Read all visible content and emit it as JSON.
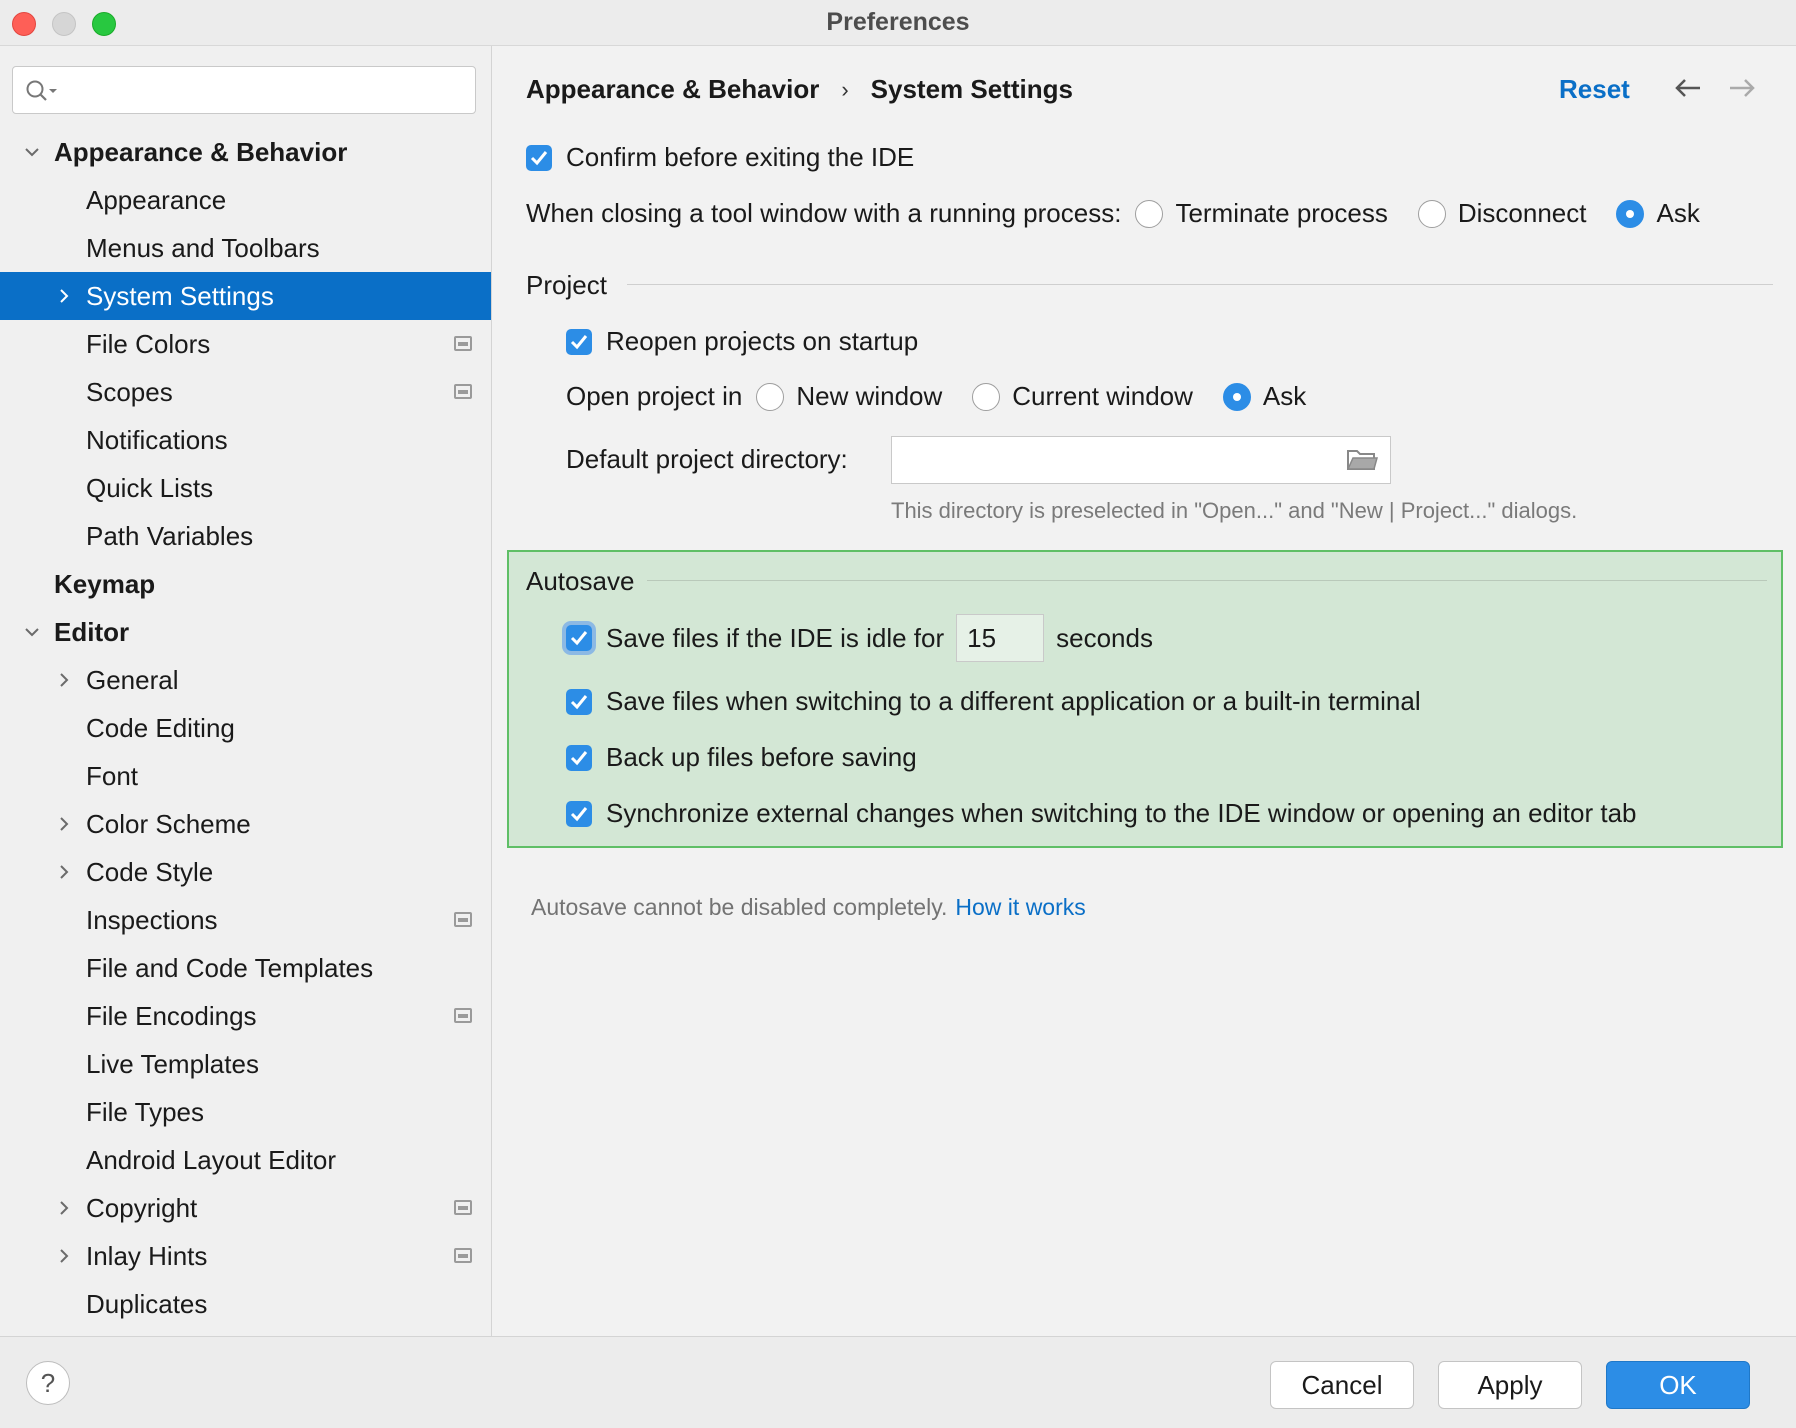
{
  "window": {
    "title": "Preferences"
  },
  "sidebar": {
    "search": {
      "placeholder": ""
    },
    "items": [
      {
        "label": "Appearance & Behavior",
        "level": 0,
        "bold": true,
        "arrow": "down"
      },
      {
        "label": "Appearance",
        "level": 1
      },
      {
        "label": "Menus and Toolbars",
        "level": 1
      },
      {
        "label": "System Settings",
        "level": 1,
        "arrow": "right",
        "selected": true
      },
      {
        "label": "File Colors",
        "level": 1,
        "project": true
      },
      {
        "label": "Scopes",
        "level": 1,
        "project": true
      },
      {
        "label": "Notifications",
        "level": 1
      },
      {
        "label": "Quick Lists",
        "level": 1
      },
      {
        "label": "Path Variables",
        "level": 1
      },
      {
        "label": "Keymap",
        "level": 0,
        "bold": true
      },
      {
        "label": "Editor",
        "level": 0,
        "bold": true,
        "arrow": "down"
      },
      {
        "label": "General",
        "level": 1,
        "arrow": "right"
      },
      {
        "label": "Code Editing",
        "level": 1
      },
      {
        "label": "Font",
        "level": 1
      },
      {
        "label": "Color Scheme",
        "level": 1,
        "arrow": "right"
      },
      {
        "label": "Code Style",
        "level": 1,
        "arrow": "right"
      },
      {
        "label": "Inspections",
        "level": 1,
        "project": true
      },
      {
        "label": "File and Code Templates",
        "level": 1
      },
      {
        "label": "File Encodings",
        "level": 1,
        "project": true
      },
      {
        "label": "Live Templates",
        "level": 1
      },
      {
        "label": "File Types",
        "level": 1
      },
      {
        "label": "Android Layout Editor",
        "level": 1
      },
      {
        "label": "Copyright",
        "level": 1,
        "arrow": "right",
        "project": true
      },
      {
        "label": "Inlay Hints",
        "level": 1,
        "arrow": "right",
        "project": true
      },
      {
        "label": "Duplicates",
        "level": 1
      }
    ]
  },
  "header": {
    "breadcrumb_parent": "Appearance & Behavior",
    "breadcrumb_sep": "›",
    "breadcrumb_current": "System Settings",
    "reset_label": "Reset"
  },
  "general": {
    "confirm_exit_label": "Confirm before exiting the IDE",
    "confirm_exit_checked": true,
    "closing_tool_label": "When closing a tool window with a running process:",
    "closing_options": [
      "Terminate process",
      "Disconnect",
      "Ask"
    ],
    "closing_selected": "Ask"
  },
  "project": {
    "title": "Project",
    "reopen_label": "Reopen projects on startup",
    "reopen_checked": true,
    "open_in_label": "Open project in",
    "open_options": [
      "New window",
      "Current window",
      "Ask"
    ],
    "open_selected": "Ask",
    "default_dir_label": "Default project directory:",
    "default_dir_value": "",
    "default_dir_hint": "This directory is preselected in \"Open...\" and \"New | Project...\" dialogs."
  },
  "autosave": {
    "title": "Autosave",
    "idle_label": "Save files if the IDE is idle for",
    "idle_value": "15",
    "idle_unit": "seconds",
    "switch_app_label": "Save files when switching to a different application or a built-in terminal",
    "backup_label": "Back up files before saving",
    "sync_label": "Synchronize external changes when switching to the IDE window or opening an editor tab",
    "note": "Autosave cannot be disabled completely.",
    "note_link": "How it works",
    "highlight_color": "#d3e7d5"
  },
  "footer": {
    "help_label": "?",
    "cancel_label": "Cancel",
    "apply_label": "Apply",
    "ok_label": "OK"
  },
  "colors": {
    "accent": "#0a6fc7",
    "checkbox": "#2c8de6"
  }
}
